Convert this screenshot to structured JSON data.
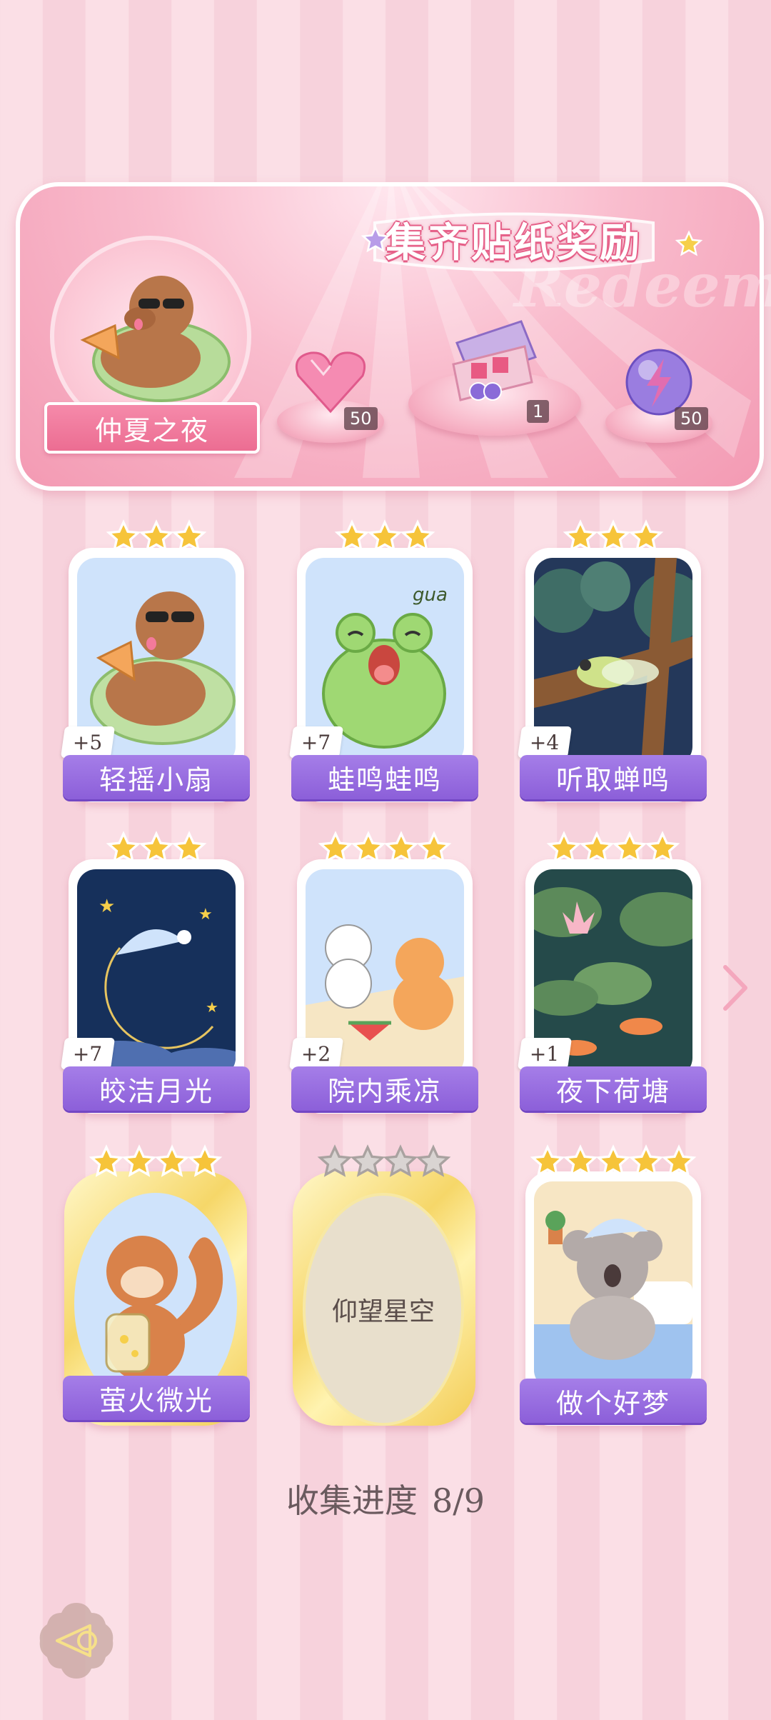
{
  "banner": {
    "title": "集齐贴纸奖励",
    "watermark": "Redeem",
    "event_name": "仲夏之夜",
    "rewards": [
      {
        "icon": "pink-heart-gem-icon",
        "count": "50"
      },
      {
        "icon": "gift-box-icon",
        "count": "1"
      },
      {
        "icon": "purple-lightning-orb-icon",
        "count": "50"
      }
    ]
  },
  "cards": [
    {
      "name": "轻摇小扇",
      "bonus": "+5",
      "stars": 3,
      "illustration": "capybara-fan"
    },
    {
      "name": "蛙鸣蛙鸣",
      "bonus": "+7",
      "stars": 3,
      "illustration": "frog",
      "caption": "gua"
    },
    {
      "name": "听取蝉鸣",
      "bonus": "+4",
      "stars": 3,
      "illustration": "cicada"
    },
    {
      "name": "皎洁月光",
      "bonus": "+7",
      "stars": 3,
      "illustration": "moon"
    },
    {
      "name": "院内乘凉",
      "bonus": "+2",
      "stars": 4,
      "illustration": "cats-watermelon"
    },
    {
      "name": "夜下荷塘",
      "bonus": "+1",
      "stars": 4,
      "illustration": "lotus-pond"
    },
    {
      "name": "萤火微光",
      "bonus": "",
      "stars": 4,
      "illustration": "squirrel-firefly"
    },
    {
      "name": "仰望星空",
      "bonus": "",
      "stars": 4,
      "illustration": "locked"
    },
    {
      "name": "做个好梦",
      "bonus": "",
      "stars": 5,
      "illustration": "koala-sleep"
    }
  ],
  "progress": {
    "label": "收集进度",
    "value": "8/9"
  },
  "colors": {
    "accent_purple": "#8c5fd9",
    "banner_pink": "#f39ab3",
    "gold_star": "#f6c43a"
  }
}
